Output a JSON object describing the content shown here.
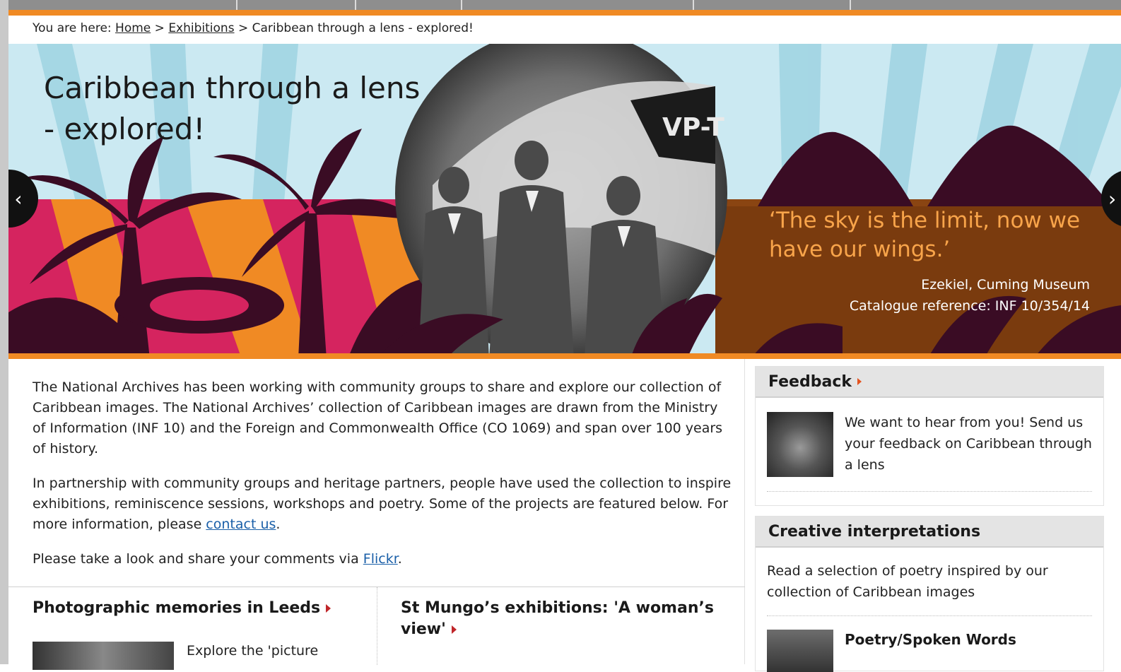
{
  "breadcrumb": {
    "prefix": "You are here:",
    "home": "Home",
    "sep1": ">",
    "exhibitions": "Exhibitions",
    "sep2": ">",
    "current": "Caribbean through a lens - explored!"
  },
  "hero": {
    "title": "Caribbean through a lens\n- explored!",
    "quote": "‘The sky is the limit, now we have our wings.’",
    "attribution": "Ezekiel, Cuming Museum",
    "catalogue": "Catalogue reference: INF 10/354/14",
    "prev_icon": "chevron-left-icon",
    "next_icon": "chevron-right-icon",
    "plane_text": "VP-T"
  },
  "intro": {
    "p1": "The National Archives has been working with community groups to share and explore our collection of Caribbean images. The National Archives’ collection of Caribbean images are drawn from the Ministry of Information (INF 10) and the Foreign and Commonwealth Office (CO 1069) and span over 100 years of history.",
    "p2_before": "In partnership with community groups and heritage partners, people have used the collection to inspire exhibitions, reminiscence sessions, workshops and poetry. Some of the projects are featured below. For more information, please ",
    "p2_link": "contact us",
    "p2_after": ".",
    "p3_before": "Please take a look and share your comments via ",
    "p3_link": "Flickr",
    "p3_after": "."
  },
  "columns": [
    {
      "title": "Photographic memories in Leeds",
      "text": "Explore the 'picture"
    },
    {
      "title": "St Mungo’s exhibitions: 'A woman’s view'"
    }
  ],
  "sidebar": {
    "feedback": {
      "title": "Feedback",
      "text": "We want to hear from you! Send us your feedback on Caribbean through a lens"
    },
    "creative": {
      "title": "Creative interpretations",
      "text": "Read a selection of poetry inspired by our collection of Caribbean images",
      "item_title": "Poetry/Spoken Words"
    }
  },
  "colors": {
    "accent_orange": "#f08a24",
    "link_blue": "#1a5fa8",
    "quote_orange": "#f8a44a",
    "arrow_red": "#c0262a"
  }
}
